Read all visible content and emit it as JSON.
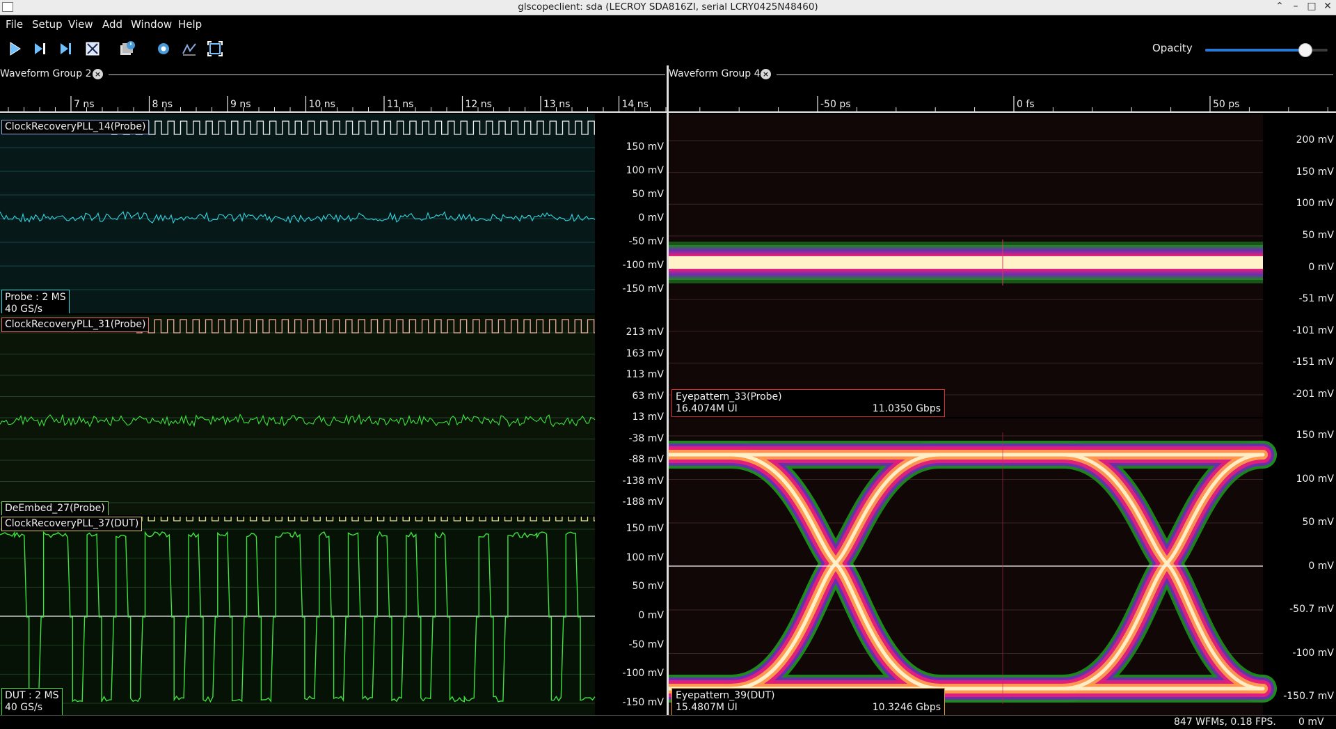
{
  "window": {
    "title": "glscopeclient: sda (LECROY SDA816ZI, serial LCRY0425N48460)",
    "controls": [
      "⌃",
      "–",
      "□",
      "✕"
    ]
  },
  "menu": [
    "File",
    "Setup",
    "View",
    "Add",
    "Window",
    "Help"
  ],
  "toolbar": {
    "buttons": [
      "start-trigger-icon",
      "single-trigger-icon",
      "force-trigger-icon",
      "stop-trigger-icon",
      "history-icon",
      "refresh-settings-icon",
      "clear-sweeps-icon",
      "fullscreen-icon"
    ],
    "opacity_label": "Opacity",
    "opacity_value": 0.82,
    "accent": "#2a7ad5"
  },
  "groups": [
    {
      "title": "Waveform Group 2",
      "timeline_ticks": [
        "7 ns",
        "8 ns",
        "9 ns",
        "10 ns",
        "11 ns",
        "12 ns",
        "13 ns",
        "14 ns"
      ],
      "panes": [
        {
          "channel_label": "ClockRecoveryPLL_14(Probe)",
          "axis": [
            "150 mV",
            "100 mV",
            "50 mV",
            "0 mV",
            "-50 mV",
            "-100 mV",
            "-150 mV"
          ],
          "info": [
            "Probe : 2 MS",
            "40 GS/s"
          ],
          "trace_color": "#34d6e0"
        },
        {
          "channel_label": "ClockRecoveryPLL_31(Probe)",
          "axis": [
            "213 mV",
            "163 mV",
            "113 mV",
            "63 mV",
            "13 mV",
            "-38 mV",
            "-88 mV",
            "-138 mV",
            "-188 mV"
          ],
          "overlay_label": "DeEmbed_27(Probe)",
          "trace_color": "#3ee33e"
        },
        {
          "channel_label": "ClockRecoveryPLL_37(DUT)",
          "axis": [
            "150 mV",
            "100 mV",
            "50 mV",
            "0 mV",
            "-50 mV",
            "-100 mV",
            "-150 mV"
          ],
          "info": [
            "DUT : 2 MS",
            "40 GS/s"
          ],
          "trace_color": "#3ee33e"
        }
      ]
    },
    {
      "title": "Waveform Group 4",
      "timeline_ticks": [
        "-50 ps",
        "0 fs",
        "50 ps"
      ],
      "panes": [
        {
          "axis": [
            "200 mV",
            "150 mV",
            "100 mV",
            "50 mV",
            "0 mV",
            "-51 mV",
            "-101 mV",
            "-151 mV",
            "-201 mV"
          ],
          "eye_name": "Eyepattern_33(Probe)",
          "eye_ui": "16.4074M UI",
          "eye_rate": "11.0350 Gbps"
        },
        {
          "axis": [
            "150 mV",
            "100 mV",
            "50 mV",
            "0 mV",
            "-50.7 mV",
            "-100 mV",
            "-150.7 mV"
          ],
          "eye_name": "Eyepattern_39(DUT)",
          "eye_ui": "15.4807M UI",
          "eye_rate": "10.3246 Gbps"
        }
      ]
    }
  ],
  "status": {
    "fps": "847 WFMs, 0.18 FPS.",
    "cursor": "0 mV"
  }
}
